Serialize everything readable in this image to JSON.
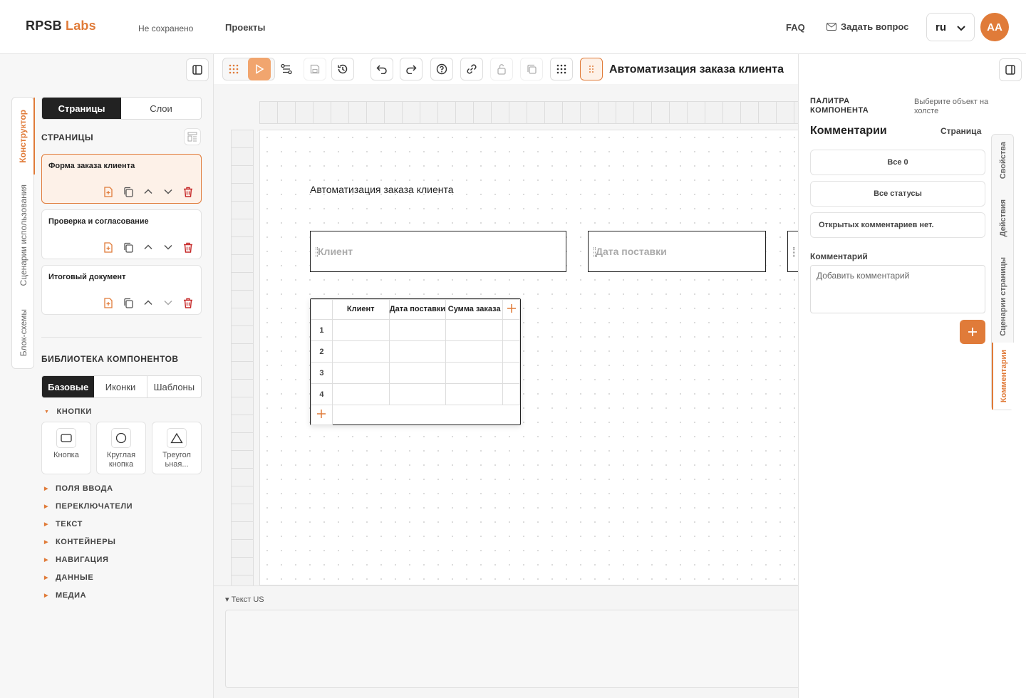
{
  "header": {
    "logo_main": "RPSB",
    "logo_accent": "Labs",
    "save_state": "Не сохранено",
    "projects": "Проекты",
    "faq": "FAQ",
    "ask": "Задать вопрос",
    "lang": "ru",
    "avatar": "AA"
  },
  "left": {
    "vtabs": [
      "Конструктор",
      "Сценарии использования",
      "Блок-схемы"
    ],
    "seg": [
      "Страницы",
      "Слои"
    ],
    "pages_title": "СТРАНИЦЫ",
    "pages": [
      "Форма заказа клиента",
      "Проверка и согласование",
      "Итоговый документ"
    ],
    "library_title": "БИБЛИОТЕКА КОМПОНЕНТОВ",
    "lib_tabs": [
      "Базовые",
      "Иконки",
      "Шаблоны"
    ],
    "categories": [
      "КНОПКИ",
      "ПОЛЯ ВВОДА",
      "ПЕРЕКЛЮЧАТЕЛИ",
      "ТЕКСТ",
      "КОНТЕЙНЕРЫ",
      "НАВИГАЦИЯ",
      "ДАННЫЕ",
      "МЕДИА"
    ],
    "components": [
      "Кнопка",
      "Круглая кнопка",
      "Треугол ьная..."
    ]
  },
  "toolbar": {
    "doc_title": "Автоматизация заказа клиента"
  },
  "canvas": {
    "title": "Автоматизация заказа клиента",
    "inputs": [
      "Клиент",
      "Дата поставки"
    ],
    "table_headers": [
      "Клиент",
      "Дата поставки",
      "Сумма заказа"
    ],
    "row_numbers": [
      "1",
      "2",
      "3",
      "4"
    ]
  },
  "bottom": {
    "label": "▾ Текст US"
  },
  "right": {
    "palette": "ПАЛИТРА КОМПОНЕНТА",
    "hint": "Выберите объект на холсте",
    "heading": "Комментарии",
    "page_link": "Страница",
    "filter_all": "Все 0",
    "filter_status": "Все статусы",
    "no_comments": "Открытых комментариев нет.",
    "comment_label": "Комментарий",
    "comment_placeholder": "Добавить комментарий",
    "vtabs": [
      "Свойства",
      "Действия",
      "Сценарии страницы",
      "Комментарии"
    ]
  },
  "colors": {
    "accent": "#e07b39",
    "dark": "#222222"
  }
}
